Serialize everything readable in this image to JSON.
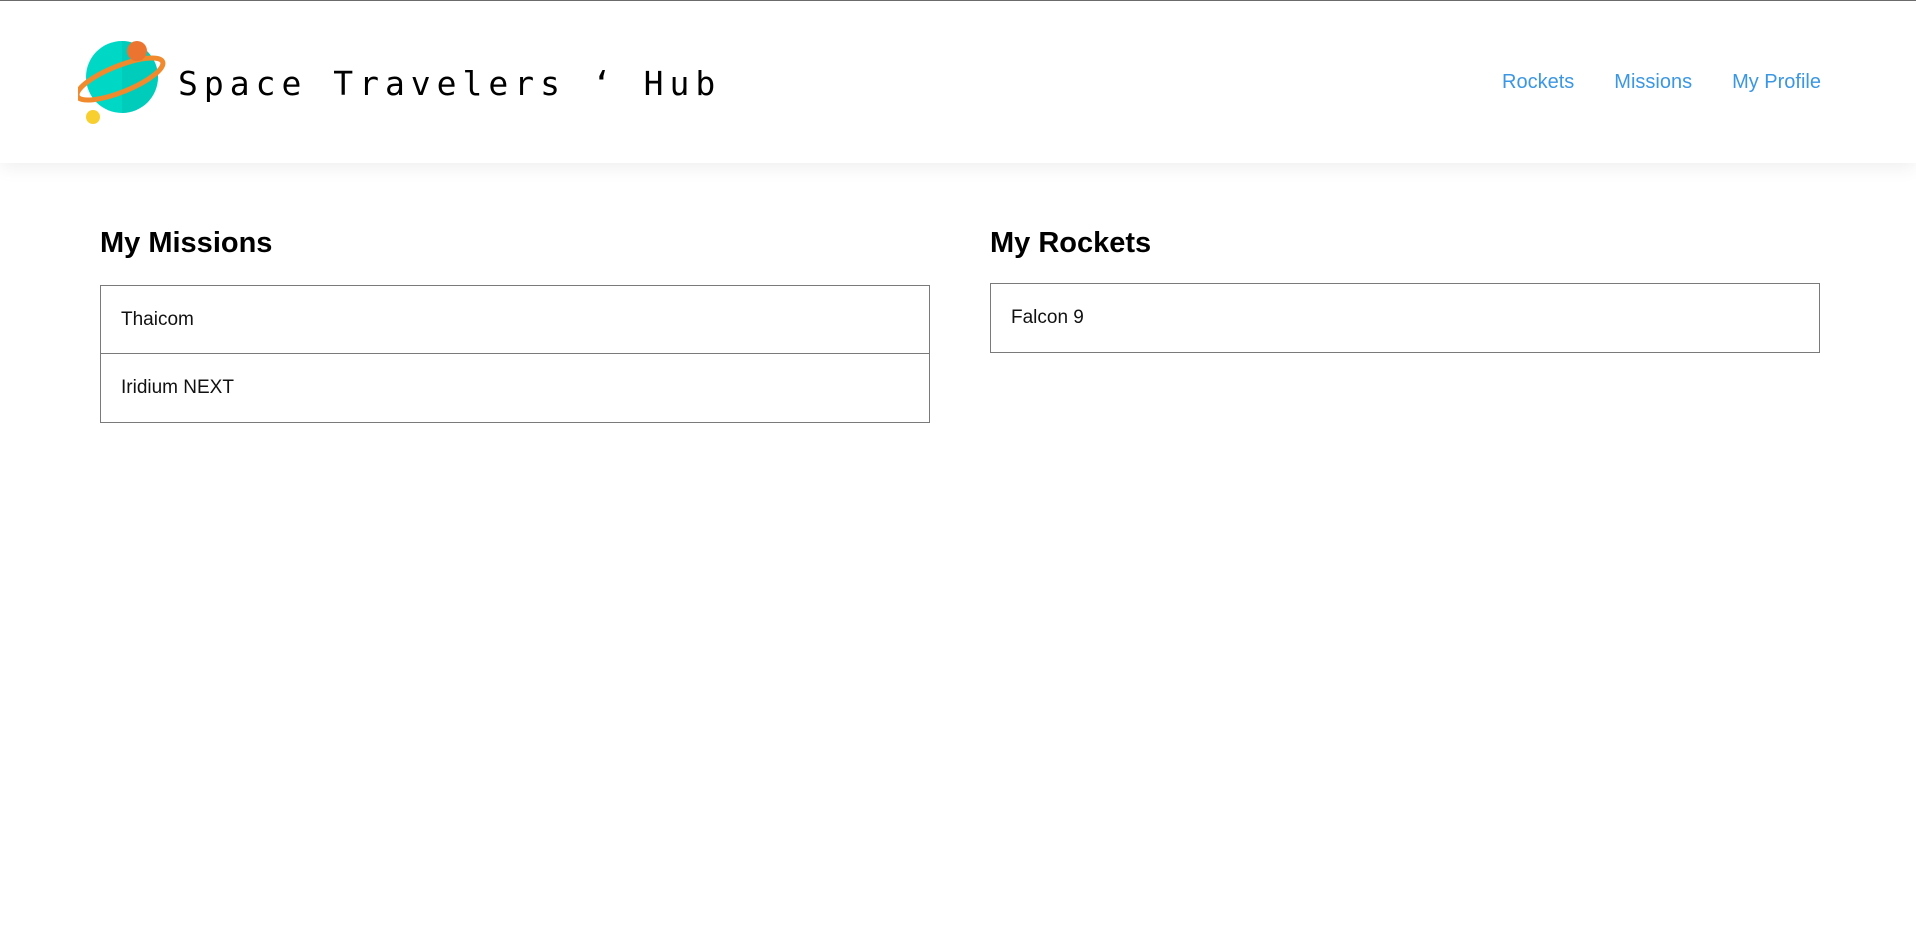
{
  "header": {
    "brand_title": "Space Travelers ‘ Hub",
    "logo_icon": "planet-icon",
    "nav": {
      "rockets": "Rockets",
      "missions": "Missions",
      "profile": "My Profile"
    },
    "nav_color": "#3b97e3"
  },
  "profile": {
    "missions": {
      "heading": "My Missions",
      "items": [
        "Thaicom",
        "Iridium NEXT"
      ]
    },
    "rockets": {
      "heading": "My Rockets",
      "items": [
        "Falcon 9"
      ]
    }
  }
}
